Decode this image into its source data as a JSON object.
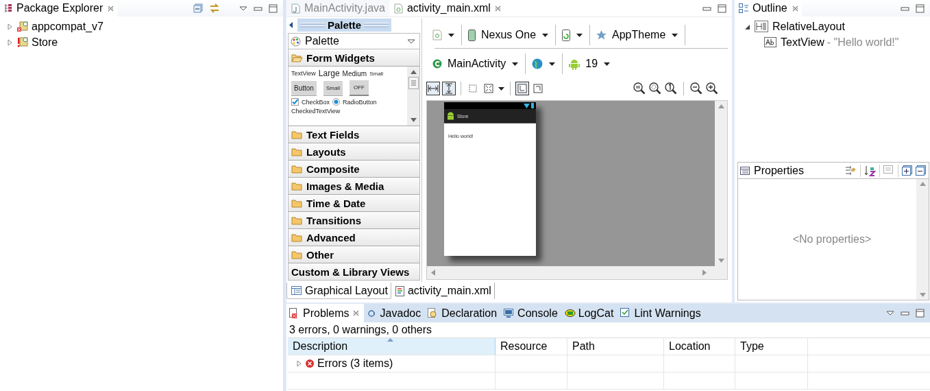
{
  "package_explorer": {
    "title": "Package Explorer",
    "items": [
      {
        "label": "appcompat_v7",
        "expanded": false,
        "kind": "library"
      },
      {
        "label": "Store",
        "expanded": false,
        "kind": "error"
      }
    ]
  },
  "editor_tabs": [
    {
      "label": "MainActivity.java",
      "selected": false,
      "kind": "java"
    },
    {
      "label": "activity_main.xml",
      "selected": true,
      "kind": "xml"
    }
  ],
  "palette": {
    "header": "Palette",
    "dropdown": "Palette",
    "categories": [
      {
        "label": "Form Widgets",
        "expanded": true,
        "kind": "folder"
      },
      {
        "label": "Text Fields",
        "expanded": false,
        "kind": "folder"
      },
      {
        "label": "Layouts",
        "expanded": false,
        "kind": "folder"
      },
      {
        "label": "Composite",
        "expanded": false,
        "kind": "folder"
      },
      {
        "label": "Images & Media",
        "expanded": false,
        "kind": "folder"
      },
      {
        "label": "Time & Date",
        "expanded": false,
        "kind": "folder"
      },
      {
        "label": "Transitions",
        "expanded": false,
        "kind": "folder"
      },
      {
        "label": "Advanced",
        "expanded": false,
        "kind": "folder"
      },
      {
        "label": "Other",
        "expanded": false,
        "kind": "folder"
      },
      {
        "label": "Custom & Library Views",
        "expanded": false,
        "kind": "plain"
      }
    ],
    "form_widgets": {
      "text_sizes": [
        {
          "label": "TextView",
          "kind": "tiny"
        },
        {
          "label": "Large",
          "kind": "large"
        },
        {
          "label": "Medium",
          "kind": "medium"
        },
        {
          "label": "Small",
          "kind": "small"
        }
      ],
      "buttons": [
        {
          "label": "Button",
          "kind": "button"
        },
        {
          "label": "Small",
          "kind": "small"
        },
        {
          "label": "OFF",
          "kind": "toggle"
        }
      ],
      "checkbox": {
        "label": "CheckBox",
        "checked": true
      },
      "radio": {
        "label": "RadioButton",
        "selected": true
      },
      "checked_text_view": "CheckedTextView"
    }
  },
  "designer_toolbar": {
    "device": "Nexus One",
    "theme": "AppTheme",
    "activity": "MainActivity",
    "api_level": "19"
  },
  "preview": {
    "app_title": "Store",
    "text": "Hello world!"
  },
  "editor_bottom_tabs": [
    {
      "label": "Graphical Layout",
      "selected": true,
      "kind": "layout"
    },
    {
      "label": "activity_main.xml",
      "selected": false,
      "kind": "xml"
    }
  ],
  "outline": {
    "title": "Outline",
    "tree": [
      {
        "label": "RelativeLayout",
        "expanded": true,
        "kind": "layout",
        "children": [
          {
            "label": "TextView",
            "detail": "- \"Hello world!\"",
            "kind": "text"
          }
        ]
      }
    ]
  },
  "properties": {
    "title": "Properties",
    "empty_text": "<No properties>"
  },
  "problems": {
    "tabs": [
      {
        "label": "Problems",
        "selected": true,
        "kind": "problems"
      },
      {
        "label": "Javadoc",
        "selected": false,
        "kind": "javadoc"
      },
      {
        "label": "Declaration",
        "selected": false,
        "kind": "declaration"
      },
      {
        "label": "Console",
        "selected": false,
        "kind": "console"
      },
      {
        "label": "LogCat",
        "selected": false,
        "kind": "logcat"
      },
      {
        "label": "Lint Warnings",
        "selected": false,
        "kind": "lint"
      }
    ],
    "summary": "3 errors, 0 warnings, 0 others",
    "columns": [
      {
        "label": "Description",
        "sorted": true
      },
      {
        "label": "Resource",
        "sorted": false
      },
      {
        "label": "Path",
        "sorted": false
      },
      {
        "label": "Location",
        "sorted": false
      },
      {
        "label": "Type",
        "sorted": false
      }
    ],
    "rows": [
      {
        "label": "Errors (3 items)",
        "expanded": false
      }
    ]
  }
}
